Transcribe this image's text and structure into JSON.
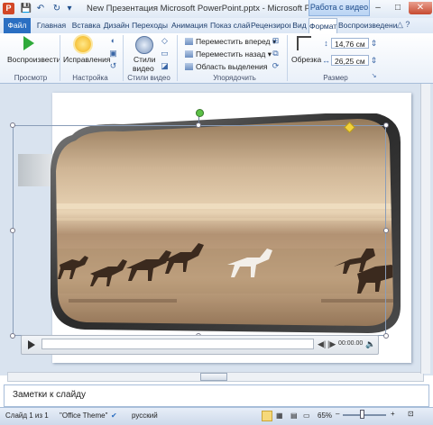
{
  "window": {
    "title": "New Презентация Microsoft PowerPoint.pptx - Microsoft PowerPoint",
    "app_icon_letter": "P",
    "context_header": "Работа с видео",
    "controls": {
      "minimize": "–",
      "maximize": "□",
      "close": "✕"
    }
  },
  "quick_access": {
    "save": "💾",
    "undo": "↶",
    "redo": "↻",
    "customize": "▾"
  },
  "tabs": [
    {
      "label": "Файл"
    },
    {
      "label": "Главная"
    },
    {
      "label": "Вставка"
    },
    {
      "label": "Дизайн"
    },
    {
      "label": "Переходы"
    },
    {
      "label": "Анимация"
    },
    {
      "label": "Показ слайд"
    },
    {
      "label": "Рецензиров"
    },
    {
      "label": "Вид"
    },
    {
      "label": "Формат"
    },
    {
      "label": "Воспроизведение"
    }
  ],
  "help_icons": "△ ?",
  "ribbon": {
    "preview": {
      "play_label": "Воспроизвести",
      "group": "Просмотр"
    },
    "adjust": {
      "corrections_label": "Исправления",
      "group": "Настройка"
    },
    "video_styles": {
      "styles_label_1": "Стили",
      "styles_label_2": "видео",
      "group": "Стили видео"
    },
    "arrange": {
      "bring_forward": "Переместить вперед",
      "send_backward": "Переместить назад",
      "selection_pane": "Область выделения",
      "group": "Упорядочить"
    },
    "size": {
      "crop_label": "Обрезка",
      "height": "14,76 см",
      "width": "26,25 см",
      "group": "Размер"
    }
  },
  "video": {
    "time": "00:00.00",
    "scene": "horses running on beach, sepia"
  },
  "notes": {
    "placeholder": "Заметки к слайду"
  },
  "status": {
    "slide": "Слайд 1 из 1",
    "theme": "\"Office Theme\"",
    "language": "русский",
    "zoom": "65%"
  },
  "colors": {
    "accent": "#2b6fc2",
    "play_green": "#2faa3a"
  }
}
